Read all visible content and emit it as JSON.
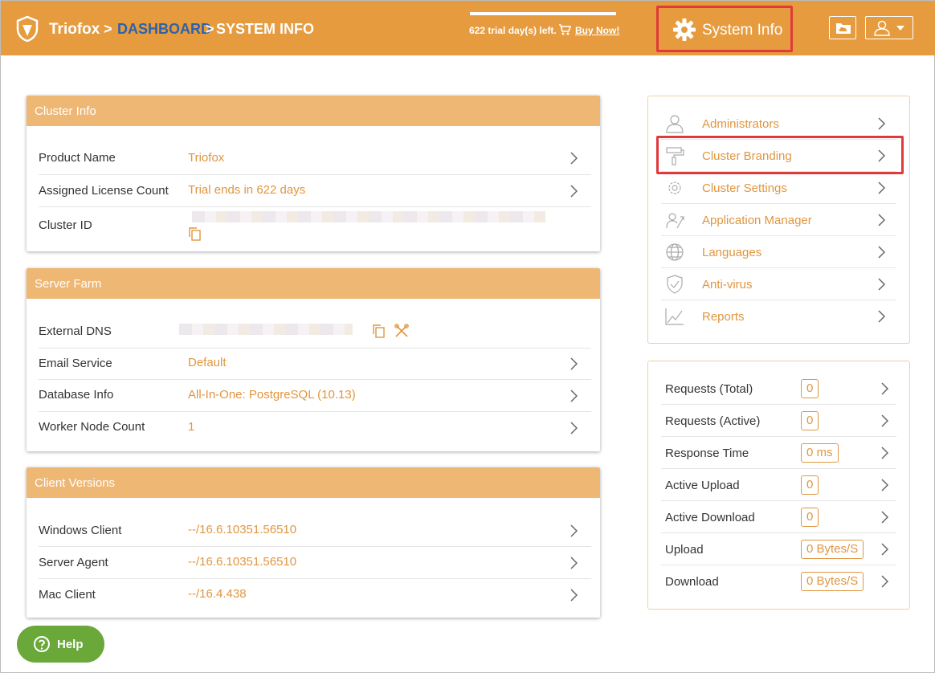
{
  "header": {
    "brand": "Triofox",
    "sep": ">",
    "dashboard": "DASHBOARD",
    "current": "SYSTEM INFO",
    "trial_text": "622 trial day(s) left.",
    "buy_now": "Buy Now!",
    "system_info": "System Info"
  },
  "cluster_info": {
    "title": "Cluster Info",
    "rows": [
      {
        "label": "Product Name",
        "value": "Triofox"
      },
      {
        "label": "Assigned License Count",
        "value": "Trial ends in 622 days"
      },
      {
        "label": "Cluster ID",
        "value": ""
      }
    ]
  },
  "server_farm": {
    "title": "Server Farm",
    "rows": [
      {
        "label": "External DNS",
        "value": ""
      },
      {
        "label": "Email Service",
        "value": "Default"
      },
      {
        "label": "Database Info",
        "value": "All-In-One: PostgreSQL (10.13)"
      },
      {
        "label": "Worker Node Count",
        "value": "1"
      }
    ]
  },
  "client_versions": {
    "title": "Client Versions",
    "rows": [
      {
        "label": "Windows Client",
        "value": "--/16.6.10351.56510"
      },
      {
        "label": "Server Agent",
        "value": "--/16.6.10351.56510"
      },
      {
        "label": "Mac Client",
        "value": "--/16.4.438"
      }
    ]
  },
  "menu": {
    "items": [
      {
        "label": "Administrators",
        "icon": "admin-user-icon"
      },
      {
        "label": "Cluster Branding",
        "icon": "paint-roller-icon"
      },
      {
        "label": "Cluster Settings",
        "icon": "gear-icon"
      },
      {
        "label": "Application Manager",
        "icon": "app-manager-icon"
      },
      {
        "label": "Languages",
        "icon": "globe-icon"
      },
      {
        "label": "Anti-virus",
        "icon": "shield-check-icon"
      },
      {
        "label": "Reports",
        "icon": "chart-icon"
      }
    ]
  },
  "stats": {
    "items": [
      {
        "label": "Requests (Total)",
        "value": "0"
      },
      {
        "label": "Requests (Active)",
        "value": "0"
      },
      {
        "label": "Response Time",
        "value": "0 ms"
      },
      {
        "label": "Active Upload",
        "value": "0"
      },
      {
        "label": "Active Download",
        "value": "0"
      },
      {
        "label": "Upload",
        "value": "0 Bytes/S"
      },
      {
        "label": "Download",
        "value": "0 Bytes/S"
      }
    ]
  },
  "help": {
    "label": "Help"
  },
  "colors": {
    "header": "#e69b3e",
    "accent": "#e09640",
    "card_head": "#eeb774",
    "link": "#2e62a8",
    "highlight": "#e03a3a",
    "help": "#6aa83a"
  }
}
